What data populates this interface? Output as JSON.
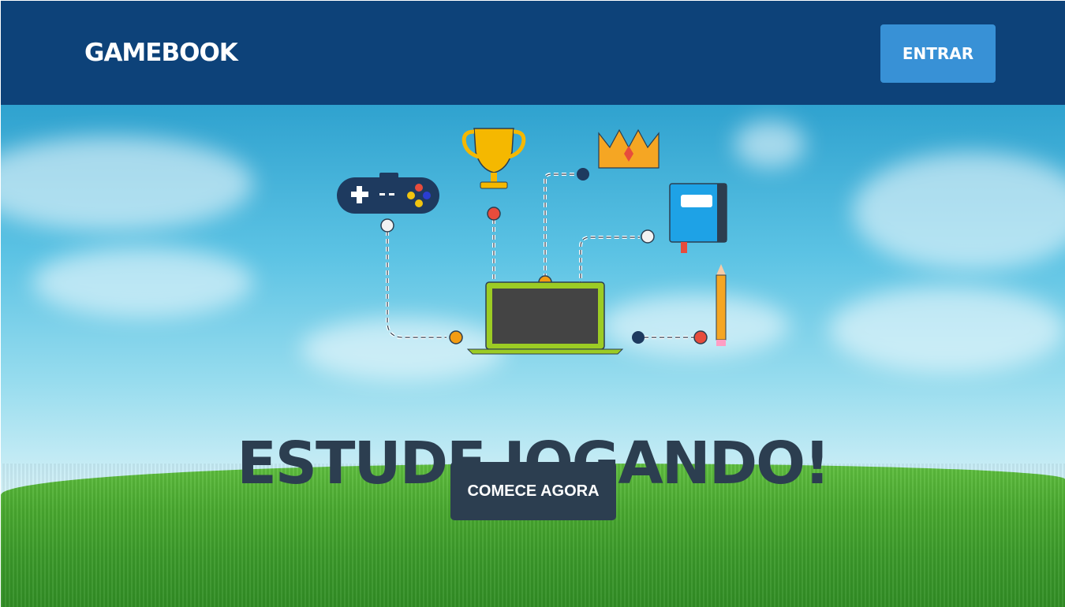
{
  "navbar": {
    "brand": "GAMEBOOK",
    "login_label": "ENTRAR"
  },
  "hero": {
    "headline": "ESTUDE JOGANDO!",
    "cta_label": "COMECE AGORA"
  },
  "illustration": {
    "icons": [
      "gamepad-icon",
      "trophy-icon",
      "crown-icon",
      "book-icon",
      "pencil-icon",
      "laptop-icon"
    ]
  },
  "colors": {
    "navbar": "#0d4279",
    "login_button": "#3891d6",
    "headline": "#2c3e50",
    "cta_button": "#2c3e50"
  }
}
